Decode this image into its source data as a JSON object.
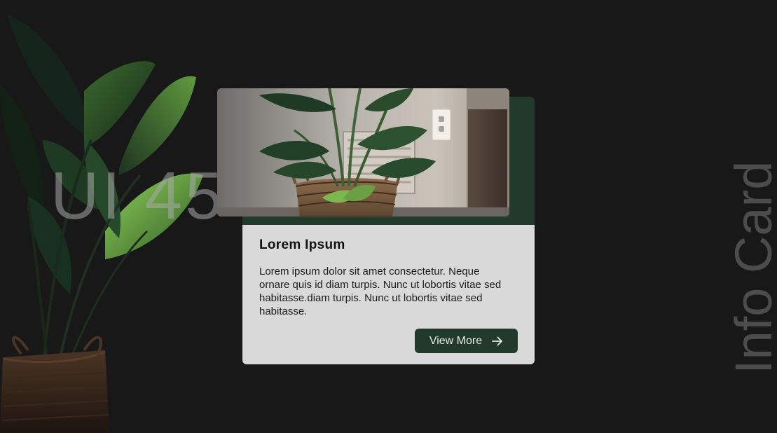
{
  "watermark": {
    "text": "UI 45"
  },
  "side_title": {
    "text": "Info Card"
  },
  "card": {
    "title": "Lorem Ipsum",
    "body": "Lorem ipsum dolor sit amet consectetur. Neque ornare quis id diam turpis. Nunc ut lobortis vitae sed habitasse.diam turpis. Nunc ut lobortis vitae sed habitasse.",
    "button_label": "View More",
    "button_icon": "arrow-right-icon"
  },
  "colors": {
    "background": "#181818",
    "accent_green": "#213a2b",
    "card_bg": "#d9d9d9",
    "text_dark": "#111111",
    "button_text": "#ecece6"
  }
}
